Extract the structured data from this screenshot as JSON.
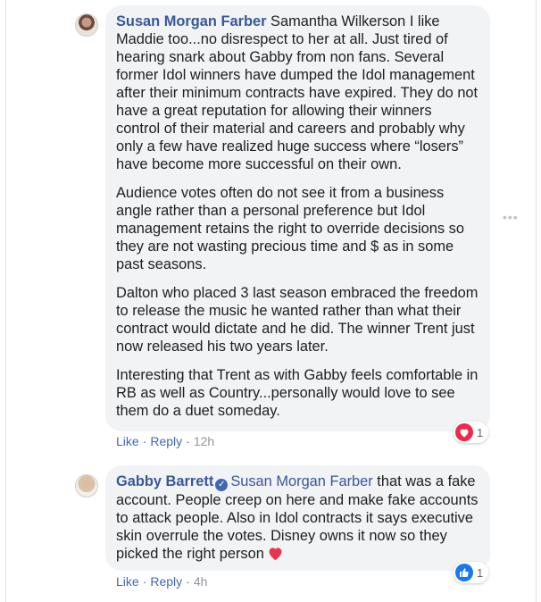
{
  "comments": [
    {
      "author": "Susan Morgan Farber",
      "paragraphs": [
        " Samantha Wilkerson I like Maddie too...no disrespect to her at all. Just tired of hearing snark about Gabby from non fans. Several former Idol winners have dumped the Idol management after their minimum contracts have expired. They do not have a great reputation for allowing their winners control of their material and careers and probably why only a few have realized huge success where “losers” have become more successful on their own.",
        "Audience votes often do not see it from a business angle rather than a personal preference but Idol management retains the right to override decisions so they are not wasting precious time and $ as in some past seasons.",
        "Dalton who placed 3 last season embraced the freedom to release the music he wanted rather than what their contract would dictate and he did. The winner Trent just now released his two years later.",
        "Interesting that Trent as with Gabby feels comfortable in RB as well as Country...personally would love to see them do a duet someday."
      ],
      "actions": {
        "like": "Like",
        "reply": "Reply",
        "separator": "·",
        "time": "12h"
      },
      "reaction": {
        "icon": "love-heart-icon",
        "count": "1",
        "color": "#f0284a"
      }
    },
    {
      "author": "Gabby Barrett",
      "verified": true,
      "mention": "Susan Morgan Farber",
      "text": " that was a fake account. People creep on here and make fake accounts to attack people. Also in Idol contracts it says executive skin overrule the votes. Disney owns it now so they picked the right person",
      "trailing_emoji": "red-heart-emoji",
      "actions": {
        "like": "Like",
        "reply": "Reply",
        "separator": "·",
        "time": "4h"
      },
      "reaction": {
        "icon": "like-thumb-icon",
        "count": "1",
        "color": "#1878f2"
      }
    }
  ],
  "colors": {
    "name_link": "#385898",
    "action_link": "#4267b2",
    "timestamp": "#90949c",
    "bubble_bg": "#f2f3f5",
    "heart": "#f0284a",
    "like": "#1878f2"
  }
}
